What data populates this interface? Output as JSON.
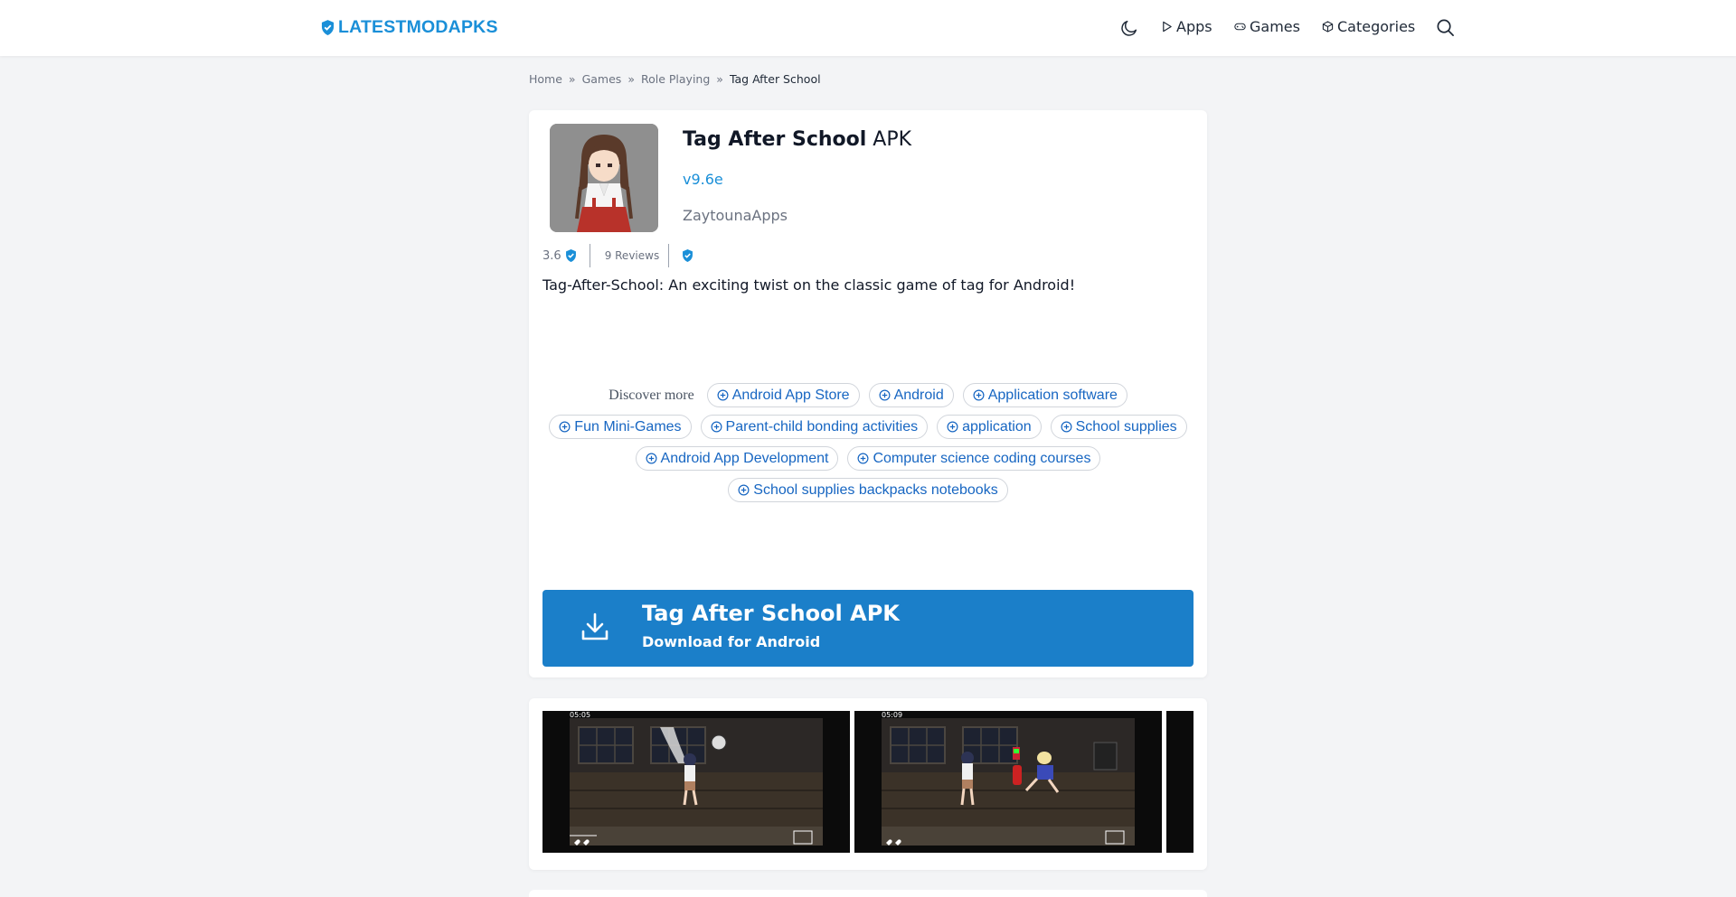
{
  "header": {
    "logo_text": "LATESTMODAPKS",
    "nav": [
      {
        "label": "Apps",
        "icon": "play-icon"
      },
      {
        "label": "Games",
        "icon": "gamepad-icon"
      },
      {
        "label": "Categories",
        "icon": "cube-icon"
      }
    ],
    "theme_icon": "moon-icon",
    "search_icon": "search-icon"
  },
  "breadcrumb": {
    "items": [
      "Home",
      "Games",
      "Role Playing"
    ],
    "separator": "»",
    "current": "Tag After School"
  },
  "app": {
    "name": "Tag After School",
    "suffix": "APK",
    "version": "v9.6e",
    "developer": "ZaytounaApps",
    "rating": "3.6",
    "reviews": "9 Reviews",
    "description": "Tag-After-School: An exciting twist on the classic game of tag for Android!"
  },
  "discover": {
    "label": "Discover more",
    "tags": [
      "Android App Store",
      "Android",
      "Application software",
      "Fun Mini-Games",
      "Parent-child bonding activities",
      "application",
      "School supplies",
      "Android App Development",
      "Computer science coding courses",
      "School supplies backpacks notebooks"
    ]
  },
  "download": {
    "title": "Tag After School APK",
    "subtitle": "Download for Android"
  },
  "screenshots": {
    "times": [
      "05:05",
      "05:09"
    ]
  },
  "colors": {
    "accent": "#1a8fd8",
    "download_bg": "#1b7fc9",
    "tag_text": "#1766c2"
  }
}
